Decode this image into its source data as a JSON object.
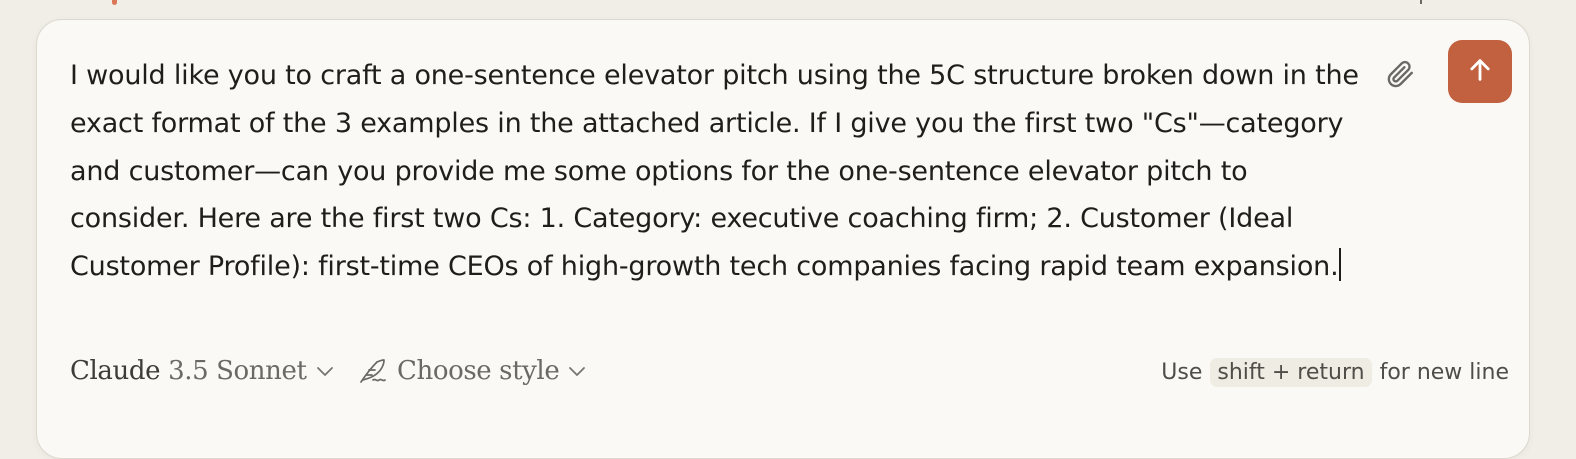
{
  "composer": {
    "prompt_text": "I would like you to craft a one-sentence elevator pitch using the 5C structure broken down in the exact format of the 3 examples in the attached article. If I give you the first two \"Cs\"—category and customer—can you provide me some options for the one-sentence elevator pitch to consider. Here are the first two Cs: 1. Category: executive coaching firm; 2. Customer (Ideal Customer Profile): first-time CEOs of high-growth tech companies facing rapid team expansion."
  },
  "toolbar": {
    "attach_icon": "paperclip-icon",
    "send_icon": "arrow-up-icon"
  },
  "model_selector": {
    "name": "Claude",
    "version": "3.5 Sonnet"
  },
  "style_selector": {
    "label": "Choose style",
    "icon": "feather-icon"
  },
  "hint": {
    "prefix": "Use",
    "keys": "shift + return",
    "suffix": "for new line"
  },
  "colors": {
    "send_button": "#c2613f",
    "background": "#f0eee6",
    "composer": "#faf9f5"
  }
}
